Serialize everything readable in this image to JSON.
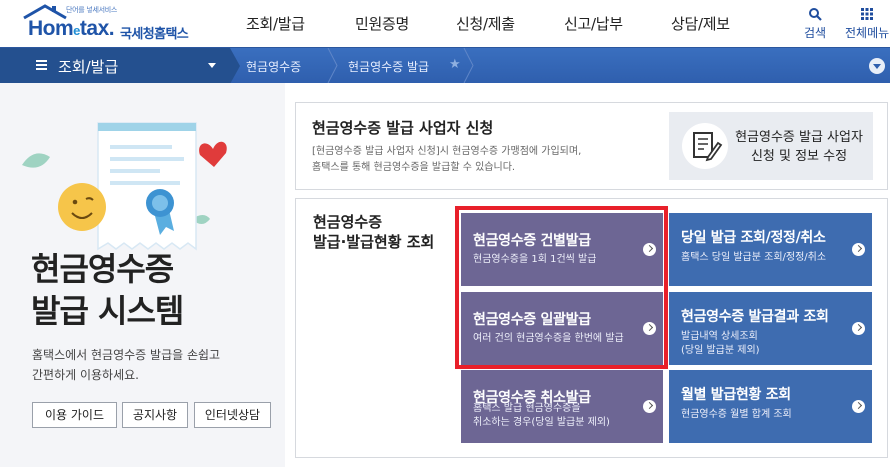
{
  "header": {
    "logo": {
      "tagline": "단어를 넣세서비스",
      "brand_en": "Hom",
      "brand_e": "e",
      "brand_en2": "tax.",
      "brand_ko": "국세청홈택스"
    },
    "nav": [
      "조회/발급",
      "민원증명",
      "신청/제출",
      "신고/납부",
      "상담/제보"
    ],
    "search_label": "검색",
    "allmenu_label": "전체메뉴"
  },
  "breadcrumb": {
    "menu_label": "조회/발급",
    "items": [
      "현금영수증",
      "현금영수증 발급"
    ]
  },
  "hero": {
    "title_line1": "현금영수증",
    "title_line2": "발급 시스템",
    "desc_line1": "홈택스에서 현금영수증 발급을 손쉽고",
    "desc_line2": "간편하게 이용하세요.",
    "buttons": [
      "이용 가이드",
      "공지사항",
      "인터넷상담"
    ]
  },
  "register": {
    "title": "현금영수증 발급 사업자 신청",
    "desc_line1": "[현금영수증 발급 사업자 신청]시 현금영수증 가맹점에 가입되며,",
    "desc_line2": "홈택스를 통해 현금영수증을 발급할 수 있습니다.",
    "button_line1": "현금영수증 발급 사업자",
    "button_line2": "신청 및 정보 수정"
  },
  "issue": {
    "title_line1": "현금영수증",
    "title_line2": "발급·발급현황 조회",
    "tiles": [
      {
        "title": "현금영수증 건별발급",
        "desc1": "현금영수증을 1회 1건씩 발급",
        "desc2": ""
      },
      {
        "title": "당일 발급 조회/정정/취소",
        "desc1": "홈택스 당일 발급분 조회/정정/취소",
        "desc2": ""
      },
      {
        "title": "현금영수증 일괄발급",
        "desc1": "여러 건의 현금영수증을 한번에 발급",
        "desc2": ""
      },
      {
        "title": "현금영수증 발급결과 조회",
        "desc1": "발급내역 상세조회",
        "desc2": "(당일 발급분 제외)"
      },
      {
        "title": "현금영수증 취소발급",
        "desc1": "홈택스 발급 현금영수증을",
        "desc2": "취소하는 경우(당일 발급분 제외)"
      },
      {
        "title": "월별 발급현황 조회",
        "desc1": "현금영수증 월별 합계 조회",
        "desc2": ""
      }
    ]
  },
  "colors": {
    "header_blue": "#2f5fae",
    "tile_purple": "#6d6694",
    "tile_blue": "#3e6cb0",
    "highlight_red": "#e8202a"
  }
}
